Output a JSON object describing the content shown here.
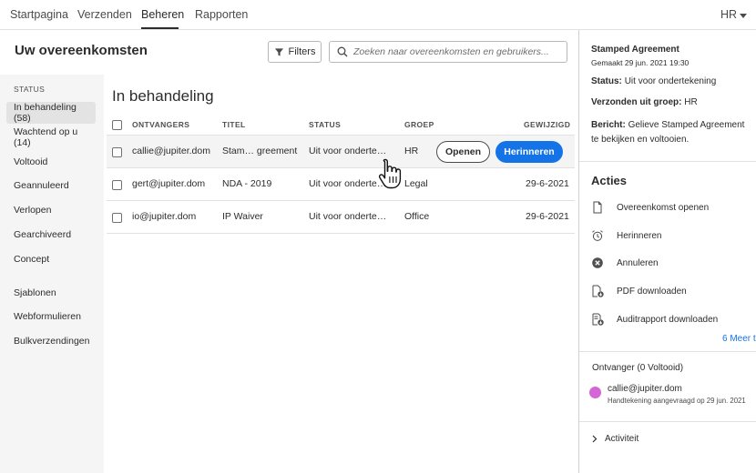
{
  "nav": {
    "tabs": [
      "Startpagina",
      "Verzenden",
      "Beheren",
      "Rapporten"
    ],
    "user": "HR"
  },
  "header": {
    "title": "Uw overeenkomsten",
    "filters_label": "Filters",
    "search_placeholder": "Zoeken naar overeenkomsten en gebruikers..."
  },
  "sidebar": {
    "section_label": "STATUS",
    "status_items": [
      "In behandeling (58)",
      "Wachtend op u (14)",
      "Voltooid",
      "Geannuleerd",
      "Verlopen",
      "Gearchiveerd",
      "Concept"
    ],
    "other_items": [
      "Sjablonen",
      "Webformulieren",
      "Bulkverzendingen"
    ]
  },
  "main": {
    "heading": "In behandeling",
    "columns": [
      "ONTVANGERS",
      "TITEL",
      "STATUS",
      "GROEP",
      "GEWIJZIGD"
    ],
    "rows": [
      {
        "recipient": "callie@jupiter.dom",
        "title": "Stam…  greement",
        "status": "Uit voor onderte…",
        "group": "HR",
        "modified": "",
        "open_label": "Openen",
        "remind_label": "Herinneren"
      },
      {
        "recipient": "gert@jupiter.dom",
        "title": "NDA - 2019",
        "status": "Uit voor onderte…",
        "group": "Legal",
        "modified": "29-6-2021"
      },
      {
        "recipient": "io@jupiter.dom",
        "title": "IP Waiver",
        "status": "Uit voor onderte…",
        "group": "Office",
        "modified": "29-6-2021"
      }
    ]
  },
  "details": {
    "title": "Stamped Agreement",
    "created": "Gemaakt 29 jun. 2021 19:30",
    "status_label": "Status:",
    "status_value": "Uit voor ondertekening",
    "group_label": "Verzonden uit groep:",
    "group_value": "HR",
    "message_label": "Bericht:",
    "message_value": "Gelieve Stamped Agreement te bekijken en voltooien.",
    "actions_title": "Acties",
    "actions": [
      {
        "label": "Overeenkomst openen",
        "icon": "document-icon"
      },
      {
        "label": "Herinneren",
        "icon": "alarm-clock-icon"
      },
      {
        "label": "Annuleren",
        "icon": "cancel-circle-icon"
      },
      {
        "label": "PDF downloaden",
        "icon": "pdf-download-icon"
      },
      {
        "label": "Auditrapport downloaden",
        "icon": "audit-report-icon"
      }
    ],
    "more_link": "6 Meer t",
    "recipients_title": "Ontvanger (0 Voltooid)",
    "recipient_email": "callie@jupiter.dom",
    "recipient_status": "Handtekening aangevraagd op 29 jun. 2021",
    "activity_label": "Activiteit"
  },
  "colors": {
    "accent": "#1473e6",
    "avatar": "#d566d6"
  }
}
